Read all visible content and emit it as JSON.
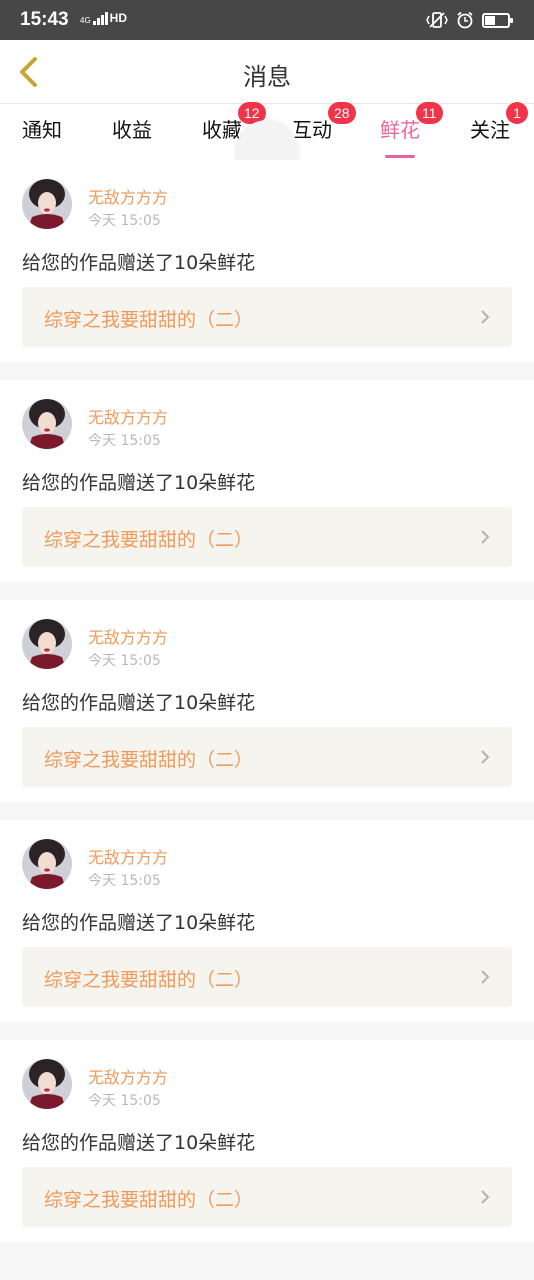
{
  "status_bar": {
    "time": "15:43",
    "network": "4G",
    "hd": "HD",
    "battery_percent": 45
  },
  "nav": {
    "title": "消息",
    "back_icon": "chevron-left-icon"
  },
  "tabs": [
    {
      "label": "通知",
      "badge": null,
      "active": false
    },
    {
      "label": "收益",
      "badge": null,
      "active": false
    },
    {
      "label": "收藏",
      "badge": "12",
      "active": false
    },
    {
      "label": "互动",
      "badge": "28",
      "active": false
    },
    {
      "label": "鲜花",
      "badge": "11",
      "active": true
    },
    {
      "label": "关注",
      "badge": "1",
      "active": false
    }
  ],
  "colors": {
    "accent": "#e8669c",
    "badge": "#f0344a",
    "highlight": "#f09a5b",
    "link_bg": "#f5f4ee"
  },
  "messages": [
    {
      "user": "无敌方方方",
      "time": "今天 15:05",
      "text": "给您的作品赠送了10朵鲜花",
      "work": "综穿之我要甜甜的（二）"
    },
    {
      "user": "无敌方方方",
      "time": "今天 15:05",
      "text": "给您的作品赠送了10朵鲜花",
      "work": "综穿之我要甜甜的（二）"
    },
    {
      "user": "无敌方方方",
      "time": "今天 15:05",
      "text": "给您的作品赠送了10朵鲜花",
      "work": "综穿之我要甜甜的（二）"
    },
    {
      "user": "无敌方方方",
      "time": "今天 15:05",
      "text": "给您的作品赠送了10朵鲜花",
      "work": "综穿之我要甜甜的（二）"
    },
    {
      "user": "无敌方方方",
      "time": "今天 15:05",
      "text": "给您的作品赠送了10朵鲜花",
      "work": "综穿之我要甜甜的（二）"
    }
  ]
}
